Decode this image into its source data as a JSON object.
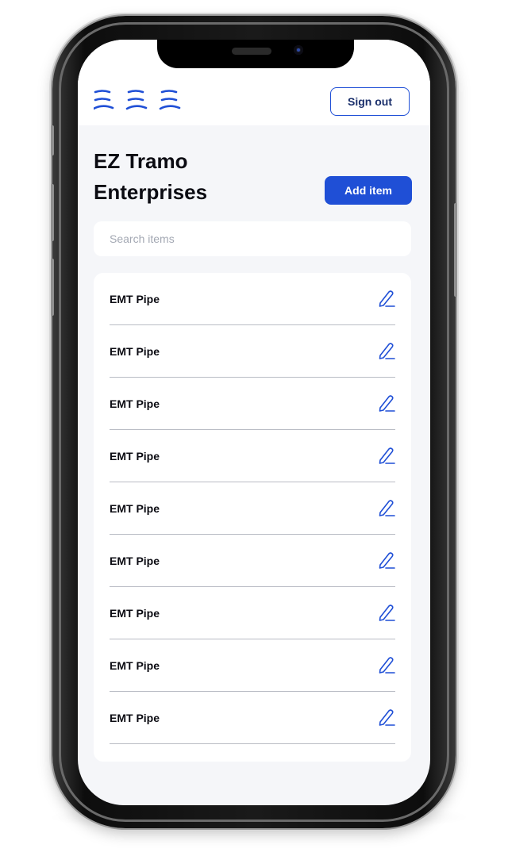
{
  "header": {
    "logo_icon": "waves-logo-icon",
    "sign_out_label": "Sign out"
  },
  "company": {
    "name": "EZ Tramo Enterprises"
  },
  "actions": {
    "add_item_label": "Add item"
  },
  "search": {
    "placeholder": "Search items",
    "value": ""
  },
  "items": [
    {
      "label": "EMT Pipe",
      "icon": "pencil-edit-icon"
    },
    {
      "label": "EMT Pipe",
      "icon": "pencil-edit-icon"
    },
    {
      "label": "EMT Pipe",
      "icon": "pencil-edit-icon"
    },
    {
      "label": "EMT Pipe",
      "icon": "pencil-edit-icon"
    },
    {
      "label": "EMT Pipe",
      "icon": "pencil-edit-icon"
    },
    {
      "label": "EMT Pipe",
      "icon": "pencil-edit-icon"
    },
    {
      "label": "EMT Pipe",
      "icon": "pencil-edit-icon"
    },
    {
      "label": "EMT Pipe",
      "icon": "pencil-edit-icon"
    },
    {
      "label": "EMT Pipe",
      "icon": "pencil-edit-icon"
    }
  ],
  "colors": {
    "accent": "#1f4fd6",
    "background": "#f5f6f9",
    "text": "#0b0b12",
    "divider": "#b9bcc4"
  }
}
